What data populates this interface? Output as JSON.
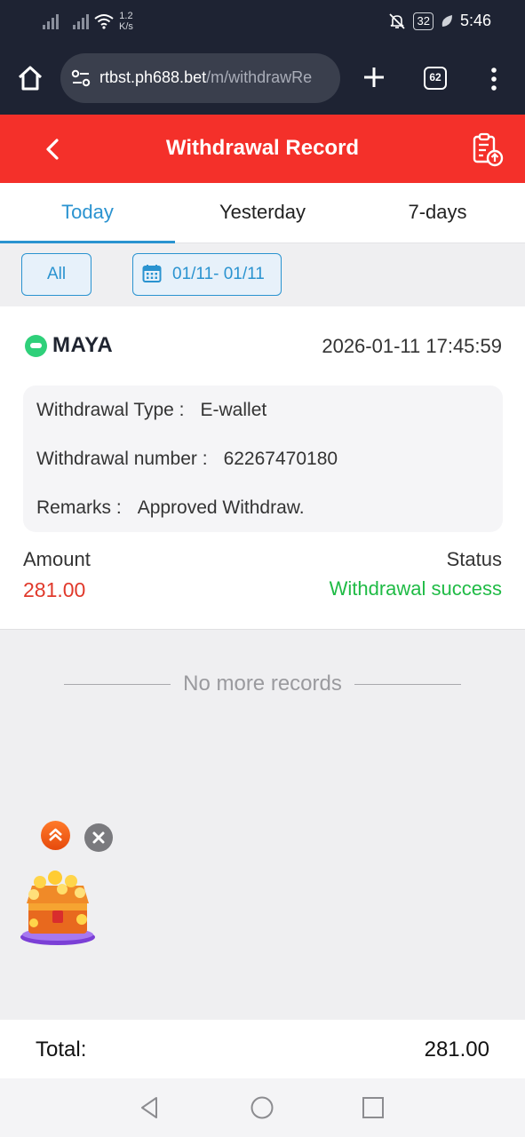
{
  "status_bar": {
    "network_speed_value": "1.2",
    "network_speed_unit": "K/s",
    "battery": "32",
    "time": "5:46",
    "icons": [
      "signal-icon",
      "signal-icon",
      "wifi-icon",
      "mute-icon",
      "battery-icon",
      "leaf-icon"
    ]
  },
  "browser": {
    "url_host": "rtbst.ph688.bet",
    "url_path": "/m/withdrawRe",
    "tab_count": "62",
    "icons": [
      "home-icon",
      "site-settings-icon",
      "plus-icon",
      "tabs-icon",
      "more-icon"
    ]
  },
  "header": {
    "title": "Withdrawal Record",
    "background": "#f4302a",
    "icons": [
      "back-icon",
      "clipboard-export-icon"
    ]
  },
  "tabs": [
    {
      "label": "Today",
      "active": true
    },
    {
      "label": "Yesterday",
      "active": false
    },
    {
      "label": "7-days",
      "active": false
    }
  ],
  "filters": {
    "type_label": "All",
    "date_range": "01/11- 01/11",
    "accent": "#2a93d0"
  },
  "record": {
    "channel": "MAYA",
    "datetime": "2026-01-11 17:45:59",
    "details": [
      {
        "label": "Withdrawal Type :",
        "value": "E-wallet"
      },
      {
        "label": "Withdrawal number :",
        "value": "62267470180"
      },
      {
        "label": "Remarks :",
        "value": "Approved Withdraw."
      }
    ],
    "amount_label": "Amount",
    "amount": "281.00",
    "amount_color": "#e0392b",
    "status_label": "Status",
    "status": "Withdrawal success",
    "status_color": "#1fbb45"
  },
  "list_end_text": "No more records",
  "floating": {
    "icons": [
      "scroll-top-icon",
      "close-icon",
      "treasure-chest-icon"
    ]
  },
  "footer": {
    "total_label": "Total:",
    "total_value": "281.00"
  },
  "nav": {
    "icons": [
      "back-nav-icon",
      "home-nav-icon",
      "recents-nav-icon"
    ]
  }
}
